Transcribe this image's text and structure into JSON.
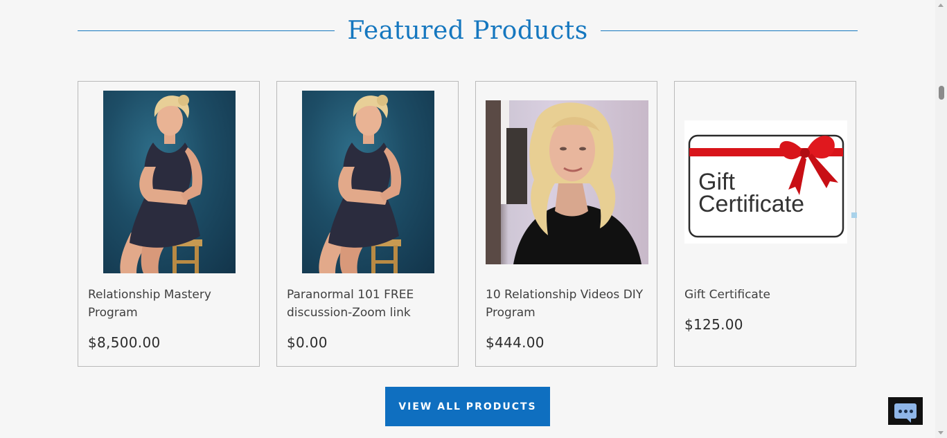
{
  "section": {
    "title": "Featured Products",
    "accent_color": "#1577bf"
  },
  "products": [
    {
      "title": "Relationship Mastery Program",
      "price": "$8,500.00",
      "image": "portrait-photo"
    },
    {
      "title": "Paranormal 101 FREE discussion-Zoom link",
      "price": "$0.00",
      "image": "portrait-photo"
    },
    {
      "title": "10 Relationship Videos DIY Program",
      "price": "$444.00",
      "image": "selfie-photo"
    },
    {
      "title": "Gift Certificate",
      "price": "$125.00",
      "image": "gift-certificate-graphic"
    }
  ],
  "gift_graphic": {
    "line1": "Gift",
    "line2": "Certificate"
  },
  "cta": {
    "label": "VIEW ALL PRODUCTS",
    "color": "#0f6fc0"
  },
  "chat": {
    "icon": "chat-bubble-icon"
  }
}
